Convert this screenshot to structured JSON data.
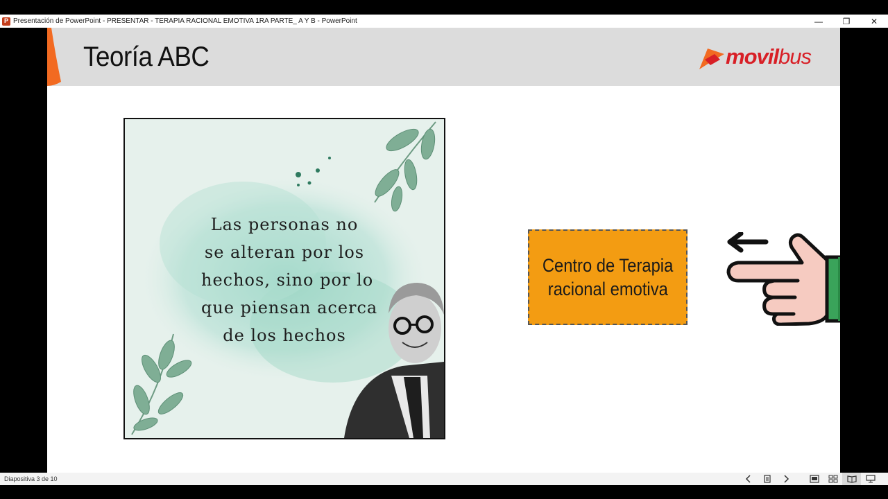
{
  "window": {
    "title": "Presentación de PowerPoint  -  PRESENTAR - TERAPIA RACIONAL EMOTIVA 1RA PARTE_ A Y B - PowerPoint",
    "app_icon_letter": "P",
    "controls": {
      "minimize": "—",
      "restore": "❐",
      "close": "✕"
    }
  },
  "slide": {
    "title": "Teoría ABC",
    "logo": {
      "part1": "movil",
      "part2": "bus",
      "color": "#d81f26"
    },
    "quote_lines": [
      "Las personas no",
      "se alteran por los",
      "hechos, sino por lo",
      "que piensan acerca",
      "de los hechos"
    ],
    "box_lines": [
      "Centro de Terapia",
      "racional emotiva"
    ],
    "box_color": "#f39c12",
    "hand_icon": "pointing-hand-left-icon"
  },
  "status": {
    "slide_counter": "Diapositiva 3 de 10",
    "icons": [
      "chevron-left-icon",
      "slide-grid-icon",
      "chevron-right-icon",
      "normal-view-icon",
      "slide-sorter-icon",
      "reading-view-icon",
      "slideshow-icon"
    ]
  }
}
